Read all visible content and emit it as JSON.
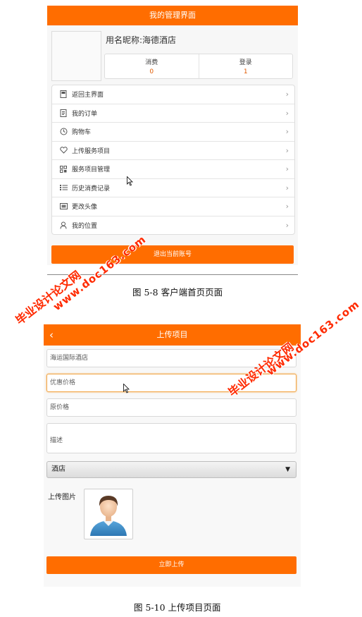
{
  "screen1": {
    "header_title": "我的管理界面",
    "nickname": "用名昵称:海德酒店",
    "stats": [
      {
        "label": "消费",
        "value": "0"
      },
      {
        "label": "登录",
        "value": "1"
      }
    ],
    "menu": [
      {
        "icon": "document-icon",
        "label": "返回主界面"
      },
      {
        "icon": "order-icon",
        "label": "我的订单"
      },
      {
        "icon": "clock-icon",
        "label": "购物车"
      },
      {
        "icon": "heart-icon",
        "label": "上传服务项目"
      },
      {
        "icon": "grid-icon",
        "label": "服务项目管理"
      },
      {
        "icon": "list-icon",
        "label": "历史消费记录"
      },
      {
        "icon": "image-icon",
        "label": "更改头像"
      },
      {
        "icon": "person-icon",
        "label": "我的位置"
      }
    ],
    "logout_label": "退出当前账号"
  },
  "caption1": "图 5-8  客户端首页页面",
  "screen2": {
    "header_title": "上传项目",
    "fields": {
      "name_value": "海运国际酒店",
      "discount_placeholder": "优惠价格",
      "original_placeholder": "原价格",
      "description_placeholder": "描述"
    },
    "category_selected": "酒店",
    "upload_label": "上传图片",
    "submit_label": "立即上传"
  },
  "caption2": "图 5-10 上传项目页面",
  "watermark": {
    "cn": "毕业设计论文网",
    "url": "www.doc163.com",
    "color": "#ff2a00"
  },
  "colors": {
    "accent": "#ff6d00",
    "stat_value": "#e05a00"
  }
}
